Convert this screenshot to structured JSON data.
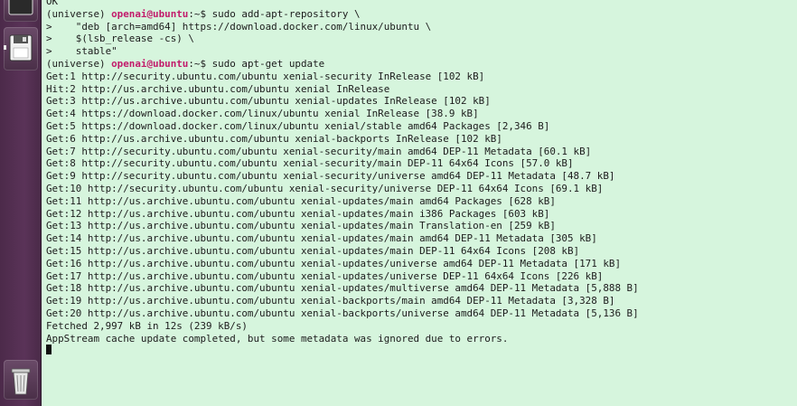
{
  "launcher": {
    "items": [
      {
        "name": "top-app-icon"
      },
      {
        "name": "save-icon"
      },
      {
        "name": "trash-icon"
      }
    ]
  },
  "terminal": {
    "prompt": {
      "env": "(universe) ",
      "user": "openai@ubuntu",
      "path": ":~$ "
    },
    "lines": [
      {
        "type": "text",
        "text": "OK"
      },
      {
        "type": "prompt",
        "cmd": "sudo add-apt-repository \\"
      },
      {
        "type": "text",
        "text": ">    \"deb [arch=amd64] https://download.docker.com/linux/ubuntu \\"
      },
      {
        "type": "text",
        "text": ">    $(lsb_release -cs) \\"
      },
      {
        "type": "text",
        "text": ">    stable\""
      },
      {
        "type": "prompt",
        "cmd": "sudo apt-get update"
      },
      {
        "type": "text",
        "text": "Get:1 http://security.ubuntu.com/ubuntu xenial-security InRelease [102 kB]"
      },
      {
        "type": "text",
        "text": "Hit:2 http://us.archive.ubuntu.com/ubuntu xenial InRelease"
      },
      {
        "type": "text",
        "text": "Get:3 http://us.archive.ubuntu.com/ubuntu xenial-updates InRelease [102 kB]"
      },
      {
        "type": "text",
        "text": "Get:4 https://download.docker.com/linux/ubuntu xenial InRelease [38.9 kB]"
      },
      {
        "type": "text",
        "text": "Get:5 https://download.docker.com/linux/ubuntu xenial/stable amd64 Packages [2,346 B]"
      },
      {
        "type": "text",
        "text": "Get:6 http://us.archive.ubuntu.com/ubuntu xenial-backports InRelease [102 kB]"
      },
      {
        "type": "text",
        "text": "Get:7 http://security.ubuntu.com/ubuntu xenial-security/main amd64 DEP-11 Metadata [60.1 kB]"
      },
      {
        "type": "text",
        "text": "Get:8 http://security.ubuntu.com/ubuntu xenial-security/main DEP-11 64x64 Icons [57.0 kB]"
      },
      {
        "type": "text",
        "text": "Get:9 http://security.ubuntu.com/ubuntu xenial-security/universe amd64 DEP-11 Metadata [48.7 kB]"
      },
      {
        "type": "text",
        "text": "Get:10 http://security.ubuntu.com/ubuntu xenial-security/universe DEP-11 64x64 Icons [69.1 kB]"
      },
      {
        "type": "text",
        "text": "Get:11 http://us.archive.ubuntu.com/ubuntu xenial-updates/main amd64 Packages [628 kB]"
      },
      {
        "type": "text",
        "text": "Get:12 http://us.archive.ubuntu.com/ubuntu xenial-updates/main i386 Packages [603 kB]"
      },
      {
        "type": "text",
        "text": "Get:13 http://us.archive.ubuntu.com/ubuntu xenial-updates/main Translation-en [259 kB]"
      },
      {
        "type": "text",
        "text": "Get:14 http://us.archive.ubuntu.com/ubuntu xenial-updates/main amd64 DEP-11 Metadata [305 kB]"
      },
      {
        "type": "text",
        "text": "Get:15 http://us.archive.ubuntu.com/ubuntu xenial-updates/main DEP-11 64x64 Icons [208 kB]"
      },
      {
        "type": "text",
        "text": "Get:16 http://us.archive.ubuntu.com/ubuntu xenial-updates/universe amd64 DEP-11 Metadata [171 kB]"
      },
      {
        "type": "text",
        "text": "Get:17 http://us.archive.ubuntu.com/ubuntu xenial-updates/universe DEP-11 64x64 Icons [226 kB]"
      },
      {
        "type": "text",
        "text": "Get:18 http://us.archive.ubuntu.com/ubuntu xenial-updates/multiverse amd64 DEP-11 Metadata [5,888 B]"
      },
      {
        "type": "text",
        "text": "Get:19 http://us.archive.ubuntu.com/ubuntu xenial-backports/main amd64 DEP-11 Metadata [3,328 B]"
      },
      {
        "type": "text",
        "text": "Get:20 http://us.archive.ubuntu.com/ubuntu xenial-backports/universe amd64 DEP-11 Metadata [5,136 B]"
      },
      {
        "type": "text",
        "text": "Fetched 2,997 kB in 12s (239 kB/s)"
      },
      {
        "type": "text",
        "text": "AppStream cache update completed, but some metadata was ignored due to errors."
      },
      {
        "type": "cursor"
      }
    ]
  },
  "colors": {
    "terminal_bg": "#d6f5dd",
    "prompt_user": "#c21b6b",
    "prompt_path": "#2e5fbf",
    "launcher_bg": "#4c2a4a"
  }
}
